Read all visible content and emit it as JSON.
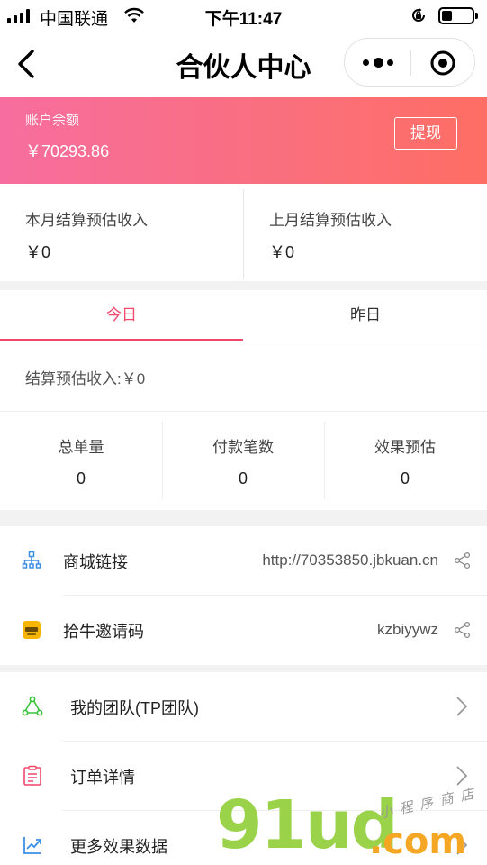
{
  "status_bar": {
    "carrier": "中国联通",
    "time": "下午11:47"
  },
  "nav": {
    "title": "合伙人中心"
  },
  "balance": {
    "label": "账户余额",
    "amount": "￥70293.86",
    "withdraw_label": "提现"
  },
  "estimates": [
    {
      "label": "本月结算预估收入",
      "value": "￥0"
    },
    {
      "label": "上月结算预估收入",
      "value": "￥0"
    }
  ],
  "tabs": [
    {
      "label": "今日",
      "active": true
    },
    {
      "label": "昨日",
      "active": false
    }
  ],
  "settlement_text": "结算预估收入:￥0",
  "metrics": [
    {
      "label": "总单量",
      "value": "0"
    },
    {
      "label": "付款笔数",
      "value": "0"
    },
    {
      "label": "效果预估",
      "value": "0"
    }
  ],
  "links": [
    {
      "name": "商城链接",
      "value": "http://70353850.jbkuan.cn",
      "icon": "org-chart-icon"
    },
    {
      "name": "拾牛邀请码",
      "value": "kzbiyywz",
      "icon": "shiniu-logo-icon"
    }
  ],
  "menu": [
    {
      "name": "我的团队(TP团队)",
      "icon": "team-icon"
    },
    {
      "name": "订单详情",
      "icon": "clipboard-icon"
    },
    {
      "name": "更多效果数据",
      "icon": "chart-up-icon"
    }
  ],
  "watermark": {
    "main": "91ud",
    "com": ".com",
    "sub": "小程序商店"
  },
  "colors": {
    "accent": "#f0476b",
    "gradient_start": "#f76d9e",
    "gradient_end": "#fe6e64"
  }
}
